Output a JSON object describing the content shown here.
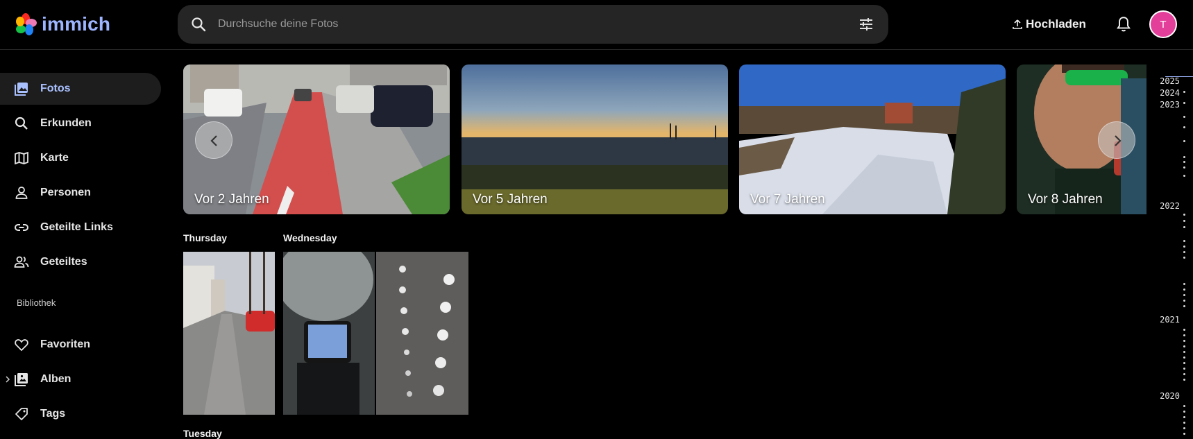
{
  "app": {
    "name": "immich"
  },
  "header": {
    "search_placeholder": "Durchsuche deine Fotos",
    "upload_label": "Hochladen",
    "avatar_initial": "T",
    "colors": {
      "avatar_bg": "#e33f9a",
      "accent": "#a9c0ff"
    }
  },
  "sidebar": {
    "items": [
      {
        "label": "Fotos",
        "icon": "photos-icon",
        "active": true
      },
      {
        "label": "Erkunden",
        "icon": "search-icon"
      },
      {
        "label": "Karte",
        "icon": "map-icon"
      },
      {
        "label": "Personen",
        "icon": "person-icon"
      },
      {
        "label": "Geteilte Links",
        "icon": "link-icon"
      },
      {
        "label": "Geteiltes",
        "icon": "shared-icon"
      }
    ],
    "library_label": "Bibliothek",
    "library_items": [
      {
        "label": "Favoriten",
        "icon": "heart-icon"
      },
      {
        "label": "Alben",
        "icon": "album-icon"
      },
      {
        "label": "Tags",
        "icon": "tag-icon"
      }
    ]
  },
  "memories": [
    {
      "label": "Vor 2 Jahren"
    },
    {
      "label": "Vor 5 Jahren"
    },
    {
      "label": "Vor 7 Jahren"
    },
    {
      "label": "Vor 8 Jahren"
    }
  ],
  "timeline": {
    "groups": [
      {
        "title": "Thursday"
      },
      {
        "title": "Wednesday"
      },
      {
        "title": "Tuesday"
      }
    ]
  },
  "scrubber": {
    "years": [
      "2025",
      "2024",
      "2023",
      "2022",
      "2021",
      "2020"
    ]
  }
}
